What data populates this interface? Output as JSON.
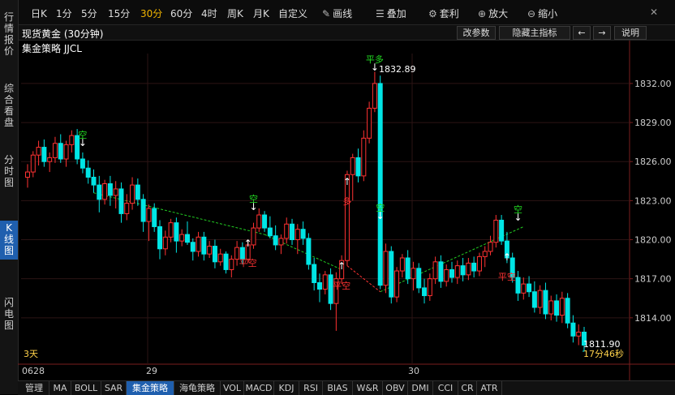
{
  "left_rail": [
    {
      "label": "行情报价",
      "active": false
    },
    {
      "label": "综合看盘",
      "active": false
    },
    {
      "label": "分时图",
      "active": false
    },
    {
      "label": "K线图",
      "active": true
    },
    {
      "label": "闪电图",
      "active": false
    }
  ],
  "toolbar": {
    "periods": [
      "日K",
      "1分",
      "5分",
      "15分",
      "30分",
      "60分",
      "4时",
      "周K",
      "月K",
      "自定义"
    ],
    "active_period": "30分",
    "tools": [
      {
        "label": "画线",
        "icon": "pencil-icon"
      },
      {
        "label": "叠加",
        "icon": "stack-icon"
      },
      {
        "label": "套利",
        "icon": "gear-icon"
      },
      {
        "label": "放大",
        "icon": "zoom-in-icon"
      },
      {
        "label": "缩小",
        "icon": "zoom-out-icon"
      }
    ]
  },
  "info_bar": {
    "title": "现货黄金 (30分钟)",
    "buttons": [
      "改参数",
      "隐藏主指标",
      "←",
      "→",
      "说明"
    ]
  },
  "strategy_label": "集金策略 JJCL",
  "days_label": "3天",
  "price_axis": [
    "1832.00",
    "1829.00",
    "1826.00",
    "1823.00",
    "1820.00",
    "1817.00",
    "1814.00"
  ],
  "date_axis": [
    "0628",
    "29",
    "30"
  ],
  "annotations": {
    "high_label": "1832.89",
    "last_price": "1811.90",
    "countdown": "17分46秒",
    "signals": [
      "空",
      "空",
      "平空",
      "多",
      "平空",
      "平多",
      "空",
      "空",
      "平空"
    ]
  },
  "colors": {
    "up": "#ff3232",
    "down": "#00e5e5",
    "buy_signal": "#ff3232",
    "sell_signal": "#22dd22",
    "grid": "#2a1414"
  },
  "bottom_tabs": [
    "管理",
    "MA",
    "BOLL",
    "SAR",
    "集金策略",
    "海龟策略",
    "VOL",
    "MACD",
    "KDJ",
    "RSI",
    "BIAS",
    "W&R",
    "OBV",
    "DMI",
    "CCI",
    "CR",
    "ATR"
  ],
  "active_tab": "集金策略",
  "chart_data": {
    "type": "candlestick",
    "ylim": [
      1810.5,
      1834.3
    ],
    "candles": [
      [
        1824.8,
        1825.8,
        1824.0,
        1825.2
      ],
      [
        1825.2,
        1826.8,
        1824.8,
        1826.5
      ],
      [
        1826.5,
        1827.6,
        1825.7,
        1827.1
      ],
      [
        1827.1,
        1827.7,
        1825.6,
        1826.0
      ],
      [
        1826.0,
        1826.7,
        1825.2,
        1826.3
      ],
      [
        1826.3,
        1827.9,
        1825.9,
        1827.4
      ],
      [
        1827.4,
        1828.1,
        1825.9,
        1826.2
      ],
      [
        1826.2,
        1827.6,
        1825.6,
        1827.3
      ],
      [
        1827.3,
        1828.4,
        1826.7,
        1828.0
      ],
      [
        1828.0,
        1828.5,
        1825.8,
        1826.2
      ],
      [
        1826.2,
        1826.7,
        1825.1,
        1825.5
      ],
      [
        1825.5,
        1826.1,
        1824.3,
        1824.8
      ],
      [
        1824.8,
        1825.4,
        1823.6,
        1824.2
      ],
      [
        1824.2,
        1824.9,
        1822.1,
        1823.1
      ],
      [
        1823.1,
        1824.6,
        1822.7,
        1824.3
      ],
      [
        1824.3,
        1824.9,
        1822.6,
        1823.4
      ],
      [
        1823.4,
        1824.5,
        1822.4,
        1823.9
      ],
      [
        1823.9,
        1824.4,
        1821.3,
        1822.0
      ],
      [
        1822.0,
        1823.5,
        1821.5,
        1822.8
      ],
      [
        1822.8,
        1824.8,
        1822.3,
        1824.2
      ],
      [
        1824.2,
        1824.7,
        1822.6,
        1823.1
      ],
      [
        1823.1,
        1823.5,
        1820.6,
        1821.4
      ],
      [
        1821.4,
        1822.7,
        1819.9,
        1822.4
      ],
      [
        1822.4,
        1822.8,
        1820.6,
        1821.0
      ],
      [
        1821.0,
        1821.5,
        1818.5,
        1819.3
      ],
      [
        1819.3,
        1820.7,
        1818.8,
        1820.2
      ],
      [
        1820.2,
        1821.6,
        1819.8,
        1821.3
      ],
      [
        1821.3,
        1821.7,
        1819.0,
        1819.9
      ],
      [
        1819.9,
        1820.8,
        1819.5,
        1820.4
      ],
      [
        1820.4,
        1821.4,
        1819.6,
        1819.8
      ],
      [
        1819.8,
        1820.1,
        1818.4,
        1819.1
      ],
      [
        1819.1,
        1820.6,
        1818.7,
        1820.2
      ],
      [
        1820.2,
        1820.6,
        1818.4,
        1818.9
      ],
      [
        1818.9,
        1819.9,
        1818.6,
        1819.5
      ],
      [
        1819.5,
        1820.0,
        1817.8,
        1818.3
      ],
      [
        1818.3,
        1819.3,
        1818.0,
        1818.9
      ],
      [
        1818.9,
        1819.1,
        1817.4,
        1817.7
      ],
      [
        1817.7,
        1818.8,
        1817.1,
        1818.5
      ],
      [
        1818.5,
        1819.9,
        1818.0,
        1819.4
      ],
      [
        1819.4,
        1819.8,
        1818.1,
        1818.5
      ],
      [
        1818.5,
        1820.0,
        1818.2,
        1819.6
      ],
      [
        1819.6,
        1821.3,
        1819.3,
        1820.9
      ],
      [
        1820.9,
        1822.4,
        1820.6,
        1821.9
      ],
      [
        1821.9,
        1822.2,
        1820.6,
        1820.9
      ],
      [
        1820.9,
        1821.8,
        1820.1,
        1820.3
      ],
      [
        1820.3,
        1821.1,
        1819.2,
        1819.6
      ],
      [
        1819.6,
        1820.4,
        1818.9,
        1820.1
      ],
      [
        1820.1,
        1821.7,
        1819.7,
        1821.2
      ],
      [
        1821.2,
        1821.6,
        1819.6,
        1820.0
      ],
      [
        1820.0,
        1821.2,
        1818.9,
        1820.8
      ],
      [
        1820.8,
        1821.4,
        1819.6,
        1820.1
      ],
      [
        1820.1,
        1820.5,
        1817.7,
        1818.1
      ],
      [
        1818.1,
        1818.6,
        1816.1,
        1816.7
      ],
      [
        1816.7,
        1817.4,
        1815.2,
        1816.2
      ],
      [
        1816.2,
        1817.6,
        1815.8,
        1817.3
      ],
      [
        1817.3,
        1817.8,
        1814.6,
        1815.1
      ],
      [
        1815.1,
        1817.5,
        1813.0,
        1817.0
      ],
      [
        1817.0,
        1818.8,
        1816.6,
        1818.4
      ],
      [
        1818.4,
        1825.3,
        1818.0,
        1825.0
      ],
      [
        1825.0,
        1826.6,
        1823.0,
        1826.3
      ],
      [
        1826.3,
        1827.0,
        1824.4,
        1824.9
      ],
      [
        1824.9,
        1828.4,
        1824.5,
        1827.8
      ],
      [
        1827.8,
        1830.6,
        1827.4,
        1830.1
      ],
      [
        1830.1,
        1832.9,
        1829.8,
        1832.0
      ],
      [
        1832.0,
        1832.6,
        1816.2,
        1816.5
      ],
      [
        1816.5,
        1819.7,
        1815.9,
        1819.1
      ],
      [
        1819.1,
        1819.5,
        1815.1,
        1815.6
      ],
      [
        1815.6,
        1817.9,
        1815.2,
        1817.6
      ],
      [
        1817.6,
        1818.9,
        1817.1,
        1818.6
      ],
      [
        1818.6,
        1819.2,
        1816.6,
        1817.0
      ],
      [
        1817.0,
        1818.3,
        1816.1,
        1817.8
      ],
      [
        1817.8,
        1818.2,
        1815.9,
        1816.3
      ],
      [
        1816.3,
        1817.0,
        1815.1,
        1815.7
      ],
      [
        1815.7,
        1817.4,
        1815.3,
        1817.0
      ],
      [
        1817.0,
        1818.7,
        1816.6,
        1818.3
      ],
      [
        1818.3,
        1818.8,
        1816.3,
        1816.8
      ],
      [
        1816.8,
        1818.1,
        1816.4,
        1817.7
      ],
      [
        1817.7,
        1818.3,
        1816.7,
        1817.1
      ],
      [
        1817.1,
        1818.4,
        1816.6,
        1818.0
      ],
      [
        1818.0,
        1818.6,
        1816.8,
        1817.3
      ],
      [
        1817.3,
        1818.6,
        1816.9,
        1818.2
      ],
      [
        1818.2,
        1818.7,
        1817.1,
        1817.6
      ],
      [
        1817.6,
        1819.0,
        1817.2,
        1818.7
      ],
      [
        1818.7,
        1819.5,
        1817.9,
        1819.1
      ],
      [
        1819.1,
        1820.3,
        1818.8,
        1819.8
      ],
      [
        1819.8,
        1821.9,
        1819.4,
        1821.5
      ],
      [
        1821.5,
        1821.9,
        1819.6,
        1819.9
      ],
      [
        1819.9,
        1820.6,
        1818.2,
        1818.6
      ],
      [
        1818.6,
        1819.0,
        1816.7,
        1817.1
      ],
      [
        1817.1,
        1817.6,
        1815.3,
        1815.9
      ],
      [
        1815.9,
        1817.1,
        1815.4,
        1816.6
      ],
      [
        1816.6,
        1817.2,
        1815.6,
        1816.0
      ],
      [
        1816.0,
        1816.8,
        1814.4,
        1814.8
      ],
      [
        1814.8,
        1816.5,
        1814.3,
        1816.1
      ],
      [
        1816.1,
        1816.7,
        1813.9,
        1814.3
      ],
      [
        1814.3,
        1815.7,
        1813.8,
        1815.3
      ],
      [
        1815.3,
        1815.8,
        1813.7,
        1814.2
      ],
      [
        1814.2,
        1816.0,
        1813.6,
        1815.5
      ],
      [
        1815.5,
        1815.9,
        1813.2,
        1813.6
      ],
      [
        1813.6,
        1814.2,
        1812.1,
        1812.6
      ],
      [
        1812.6,
        1813.5,
        1811.9,
        1812.9
      ],
      [
        1812.9,
        1813.3,
        1811.7,
        1811.9
      ]
    ]
  }
}
